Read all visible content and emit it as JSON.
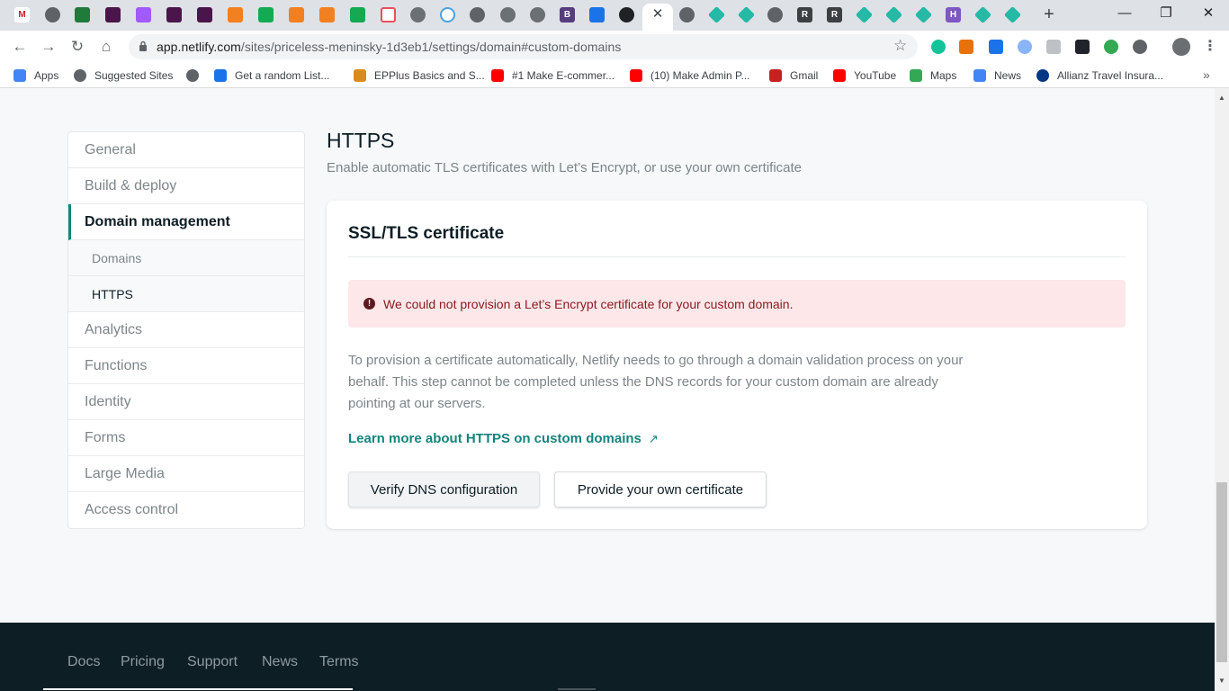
{
  "browser": {
    "url_domain": "app.netlify.com",
    "url_path": "/sites/priceless-meninsky-1d3eb1/settings/domain#custom-domains",
    "tab_close": "✕",
    "new_tab": "+",
    "window_controls": [
      "—",
      "❐",
      "✕"
    ],
    "bookmarks": [
      {
        "label": "Apps",
        "color": "#4285f4"
      },
      {
        "label": "Suggested Sites",
        "color": "#5f6368"
      },
      {
        "label": "",
        "color": "#5f6368"
      },
      {
        "label": "Get a random List...",
        "color": "#1a73e8"
      },
      {
        "label": "EPPlus Basics and S...",
        "color": "#d98b1e"
      },
      {
        "label": "#1 Make E-commer...",
        "color": "#ff0000"
      },
      {
        "label": "(10) Make Admin P...",
        "color": "#ff0000"
      },
      {
        "label": "Gmail",
        "color": "#c5221f"
      },
      {
        "label": "YouTube",
        "color": "#ff0000"
      },
      {
        "label": "Maps",
        "color": "#34a853"
      },
      {
        "label": "News",
        "color": "#4285f4"
      },
      {
        "label": "Allianz Travel Insura...",
        "color": "#003781"
      }
    ],
    "bookmarks_more": "»"
  },
  "sidebar": {
    "items": [
      {
        "label": "General"
      },
      {
        "label": "Build & deploy"
      },
      {
        "label": "Domain management"
      },
      {
        "label": "Domains"
      },
      {
        "label": "HTTPS"
      },
      {
        "label": "Analytics"
      },
      {
        "label": "Functions"
      },
      {
        "label": "Identity"
      },
      {
        "label": "Forms"
      },
      {
        "label": "Large Media"
      },
      {
        "label": "Access control"
      }
    ]
  },
  "section": {
    "title": "HTTPS",
    "subtitle": "Enable automatic TLS certificates with Let’s Encrypt, or use your own certificate"
  },
  "card": {
    "title": "SSL/TLS certificate",
    "alert": "We could not provision a Let’s Encrypt certificate for your custom domain.",
    "alert_icon": "!",
    "description": "To provision a certificate automatically, Netlify needs to go through a domain validation process on your behalf. This step cannot be completed unless the DNS records for your custom domain are already pointing at our servers.",
    "link": "Learn more about HTTPS on custom domains",
    "link_arrow": "↗",
    "verify_button": "Verify DNS configuration",
    "provide_button": "Provide your own certificate"
  },
  "footer": {
    "links": [
      "Docs",
      "Pricing",
      "Support",
      "News",
      "Terms"
    ]
  },
  "colors": {
    "accent": "#15847d",
    "alert_bg": "#fde7e9",
    "alert_text": "#8a1c22",
    "footer_bg": "#0e1e25"
  }
}
